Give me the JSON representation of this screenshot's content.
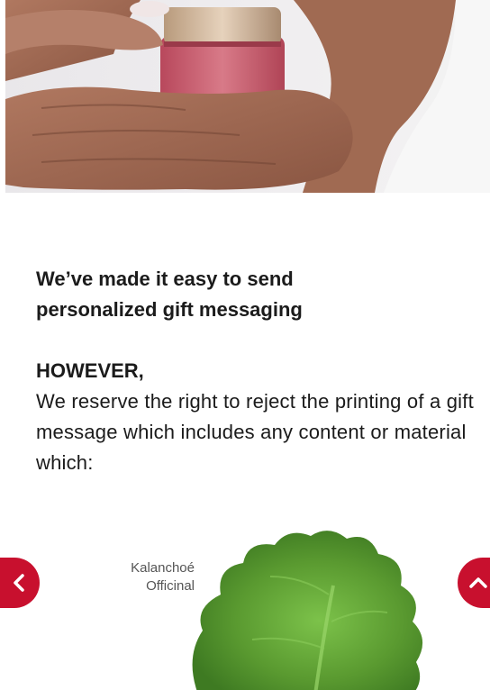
{
  "hero": {
    "image_icon": "skincare-jar-hands-photo",
    "jar_color": "#c85a6c"
  },
  "content": {
    "headline": "We’ve made it easy to send personalized gift messaging",
    "however": "HOWEVER,",
    "body": "We reserve the right to reject the printing of a gift message which includes any content or material which:"
  },
  "carousel": {
    "item_label_line1": "Kalanchoé",
    "item_label_line2": "Officinal",
    "prev_icon": "chevron-left-icon",
    "next_icon": "chevron-up-icon",
    "accent_color": "#c8102e",
    "leaf_color": "#5fa032"
  }
}
